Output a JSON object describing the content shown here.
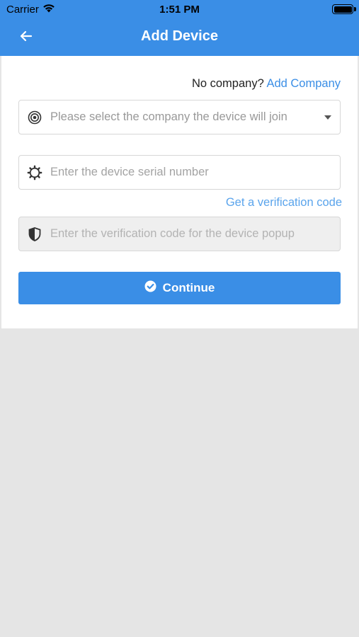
{
  "status_bar": {
    "carrier": "Carrier",
    "time": "1:51 PM",
    "icons": [
      "wifi-icon",
      "battery-icon"
    ]
  },
  "nav": {
    "title": "Add Device",
    "back_icon": "arrow-left-icon"
  },
  "form": {
    "company_prompt": "No company?",
    "add_company_label": "Add Company",
    "company_select": {
      "placeholder": "Please select the company the device will join",
      "icon": "target-icon",
      "caret_icon": "caret-down-icon"
    },
    "serial": {
      "placeholder": "Enter the device serial number",
      "icon": "gear-icon"
    },
    "verification_link": "Get a verification code",
    "verification": {
      "placeholder": "Enter the verification code for the device popup",
      "icon": "shield-icon"
    },
    "continue_label": "Continue",
    "continue_icon": "check-circle-icon"
  },
  "colors": {
    "brand": "#3a8ee6",
    "link": "#5aa4ec",
    "background": "#e5e5e5"
  }
}
